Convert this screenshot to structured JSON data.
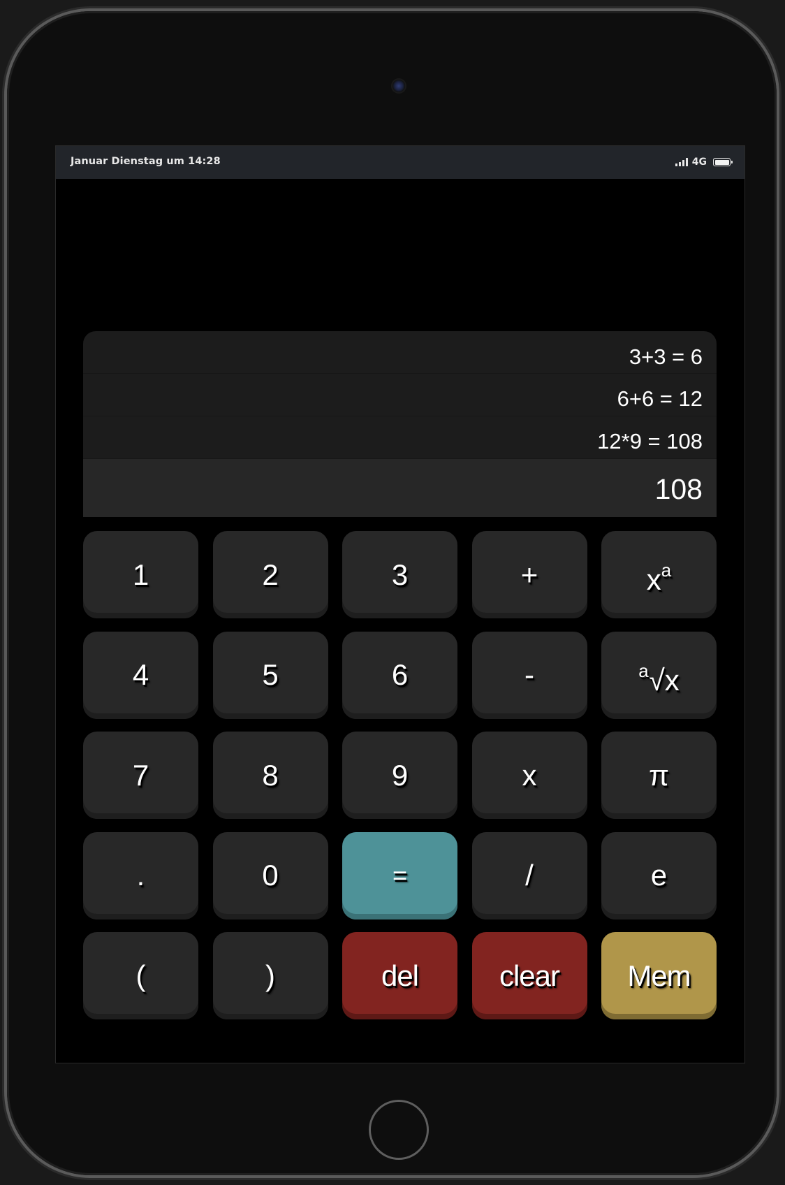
{
  "status_bar": {
    "datetime": "Januar Dienstag um 14:28",
    "network": "4G",
    "battery_level": 1.0
  },
  "display": {
    "history": [
      "3+3 = 6",
      "6+6 = 12",
      "12*9 = 108"
    ],
    "result": "108"
  },
  "keys": {
    "one": "1",
    "two": "2",
    "three": "3",
    "plus": "+",
    "power_base": "x",
    "power_exp": "a",
    "four": "4",
    "five": "5",
    "six": "6",
    "minus": "-",
    "root_index": "a",
    "root_body": "√x",
    "seven": "7",
    "eight": "8",
    "nine": "9",
    "multiply": "x",
    "pi": "π",
    "decimal": ".",
    "zero": "0",
    "equals": "=",
    "divide": "/",
    "euler": "e",
    "open_paren": "(",
    "close_paren": ")",
    "delete": "del",
    "clear": "clear",
    "memory": "Mem"
  },
  "colors": {
    "key_default": "#282828",
    "key_equals": "#4e9298",
    "key_danger": "#822420",
    "key_memory": "#b0964a",
    "display_background": "#1c1c1c",
    "status_bar": "#22252a"
  },
  "icons": {
    "signal": "cellular-signal-icon",
    "battery": "battery-icon"
  }
}
